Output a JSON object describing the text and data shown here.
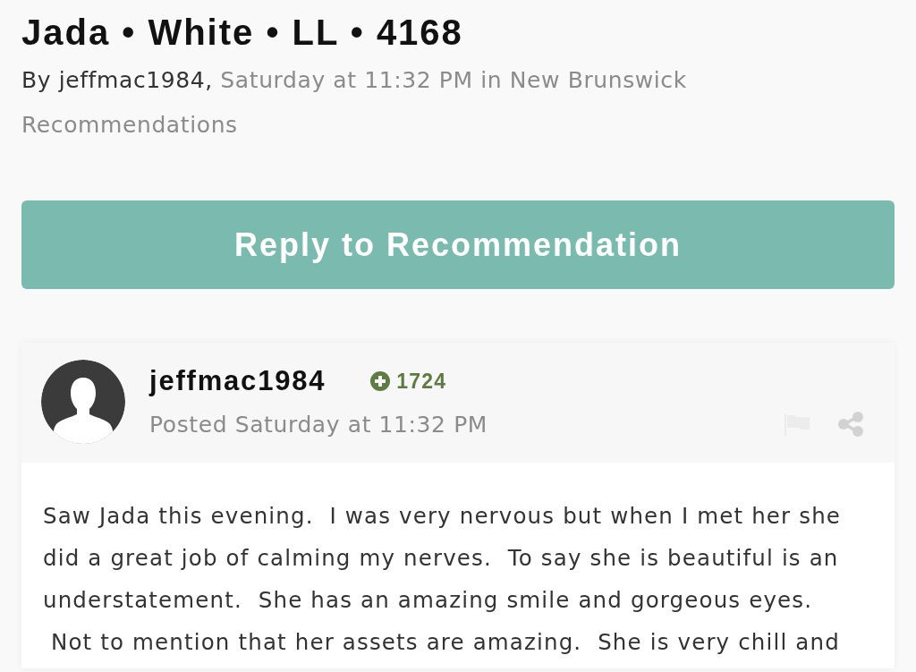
{
  "topic": {
    "title": "Jada • White • LL • 4168",
    "byline_author": "By jeffmac1984, ",
    "byline_rest": "Saturday at 11:32 PM in New Brunswick Recommendations"
  },
  "reply_button": {
    "label": "Reply to Recommendation"
  },
  "post": {
    "author": "jeffmac1984",
    "reputation": "1724",
    "posted": "Posted Saturday at 11:32 PM",
    "body": "Saw Jada this evening.  I was very nervous but when I met her she\ndid a great job of calming my nerves.  To say she is beautiful is an\nunderstatement.  She has an amazing smile and gorgeous eyes.\n Not to mention that her assets are amazing.  She is very chill and"
  }
}
